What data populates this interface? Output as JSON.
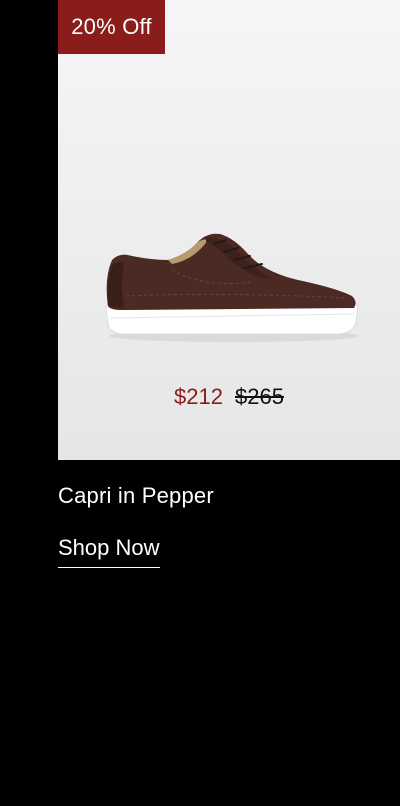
{
  "badge": {
    "label": "20% Off"
  },
  "price": {
    "sale": "$212",
    "original": "$265"
  },
  "product": {
    "name": "Capri in Pepper"
  },
  "cta": {
    "label": "Shop Now"
  },
  "colors": {
    "badge_bg": "#8a1c1c",
    "sale_price": "#8a1c1c",
    "page_bg": "#000000",
    "card_bg": "#efefef"
  },
  "image": {
    "subject": "brown suede low-top sneaker with white sole",
    "icon": "sneaker-image"
  }
}
